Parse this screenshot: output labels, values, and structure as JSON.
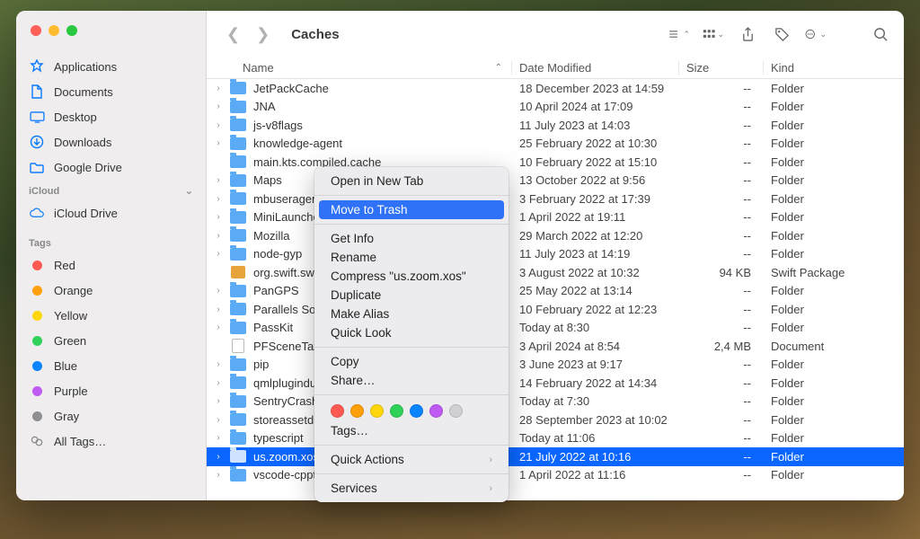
{
  "window": {
    "title": "Caches"
  },
  "sidebar": {
    "favorites": [
      {
        "icon": "apps",
        "label": "Applications"
      },
      {
        "icon": "doc",
        "label": "Documents"
      },
      {
        "icon": "desktop",
        "label": "Desktop"
      },
      {
        "icon": "download",
        "label": "Downloads"
      },
      {
        "icon": "folder",
        "label": "Google Drive"
      }
    ],
    "icloud_label": "iCloud",
    "icloud": [
      {
        "icon": "cloud",
        "label": "iCloud Drive"
      }
    ],
    "tags_label": "Tags",
    "tags": [
      {
        "color": "#ff5a52",
        "label": "Red"
      },
      {
        "color": "#ff9f0a",
        "label": "Orange"
      },
      {
        "color": "#ffd60a",
        "label": "Yellow"
      },
      {
        "color": "#30d158",
        "label": "Green"
      },
      {
        "color": "#0a84ff",
        "label": "Blue"
      },
      {
        "color": "#bf5af2",
        "label": "Purple"
      },
      {
        "color": "#8e8e93",
        "label": "Gray"
      }
    ],
    "all_tags": "All Tags…"
  },
  "columns": {
    "name": "Name",
    "date": "Date Modified",
    "size": "Size",
    "kind": "Kind"
  },
  "files": [
    {
      "exp": true,
      "icon": "folder",
      "name": "JetPackCache",
      "date": "18 December 2023 at 14:59",
      "size": "--",
      "kind": "Folder"
    },
    {
      "exp": true,
      "icon": "folder",
      "name": "JNA",
      "date": "10 April 2024 at 17:09",
      "size": "--",
      "kind": "Folder"
    },
    {
      "exp": true,
      "icon": "folder",
      "name": "js-v8flags",
      "date": "11 July 2023 at 14:03",
      "size": "--",
      "kind": "Folder"
    },
    {
      "exp": true,
      "icon": "folder",
      "name": "knowledge-agent",
      "date": "25 February 2022 at 10:30",
      "size": "--",
      "kind": "Folder"
    },
    {
      "exp": false,
      "icon": "folder",
      "name": "main.kts.compiled.cache",
      "date": "10 February 2022 at 15:10",
      "size": "--",
      "kind": "Folder"
    },
    {
      "exp": true,
      "icon": "folder",
      "name": "Maps",
      "date": "13 October 2022 at 9:56",
      "size": "--",
      "kind": "Folder"
    },
    {
      "exp": true,
      "icon": "folder",
      "name": "mbuseragent",
      "date": "3 February 2022 at 17:39",
      "size": "--",
      "kind": "Folder"
    },
    {
      "exp": true,
      "icon": "folder",
      "name": "MiniLauncher",
      "date": "1 April 2022 at 19:11",
      "size": "--",
      "kind": "Folder"
    },
    {
      "exp": true,
      "icon": "folder",
      "name": "Mozilla",
      "date": "29 March 2022 at 12:20",
      "size": "--",
      "kind": "Folder"
    },
    {
      "exp": true,
      "icon": "folder",
      "name": "node-gyp",
      "date": "11 July 2023 at 14:19",
      "size": "--",
      "kind": "Folder"
    },
    {
      "exp": false,
      "icon": "pkg",
      "name": "org.swift.swiftpm",
      "date": "3 August 2022 at 10:32",
      "size": "94 KB",
      "kind": "Swift Package"
    },
    {
      "exp": true,
      "icon": "folder",
      "name": "PanGPS",
      "date": "25 May 2022 at 13:14",
      "size": "--",
      "kind": "Folder"
    },
    {
      "exp": true,
      "icon": "folder",
      "name": "Parallels Software",
      "date": "10 February 2022 at 12:23",
      "size": "--",
      "kind": "Folder"
    },
    {
      "exp": true,
      "icon": "folder",
      "name": "PassKit",
      "date": "Today at 8:30",
      "size": "--",
      "kind": "Folder"
    },
    {
      "exp": false,
      "icon": "doc",
      "name": "PFSceneTaxonomy.plist",
      "date": "3 April 2024 at 8:54",
      "size": "2,4 MB",
      "kind": "Document"
    },
    {
      "exp": true,
      "icon": "folder",
      "name": "pip",
      "date": "3 June 2023 at 9:17",
      "size": "--",
      "kind": "Folder"
    },
    {
      "exp": true,
      "icon": "folder",
      "name": "qmlplugindump",
      "date": "14 February 2022 at 14:34",
      "size": "--",
      "kind": "Folder"
    },
    {
      "exp": true,
      "icon": "folder",
      "name": "SentryCrash",
      "date": "Today at 7:30",
      "size": "--",
      "kind": "Folder"
    },
    {
      "exp": true,
      "icon": "folder",
      "name": "storeassetd",
      "date": "28 September 2023 at 10:02",
      "size": "--",
      "kind": "Folder"
    },
    {
      "exp": true,
      "icon": "folder",
      "name": "typescript",
      "date": "Today at 11:06",
      "size": "--",
      "kind": "Folder"
    },
    {
      "exp": true,
      "icon": "folder",
      "name": "us.zoom.xos",
      "date": "21 July 2022 at 10:16",
      "size": "--",
      "kind": "Folder",
      "selected": true
    },
    {
      "exp": true,
      "icon": "folder",
      "name": "vscode-cpptools",
      "date": "1 April 2022 at 11:16",
      "size": "--",
      "kind": "Folder"
    }
  ],
  "context_menu": {
    "open_tab": "Open in New Tab",
    "move_trash": "Move to Trash",
    "get_info": "Get Info",
    "rename": "Rename",
    "compress": "Compress \"us.zoom.xos\"",
    "duplicate": "Duplicate",
    "make_alias": "Make Alias",
    "quick_look": "Quick Look",
    "copy": "Copy",
    "share": "Share…",
    "tags": "Tags…",
    "quick_actions": "Quick Actions",
    "services": "Services",
    "tag_colors": [
      "#ff5a52",
      "#ff9f0a",
      "#ffd60a",
      "#30d158",
      "#0a84ff",
      "#bf5af2",
      "#d0d0d4"
    ]
  }
}
